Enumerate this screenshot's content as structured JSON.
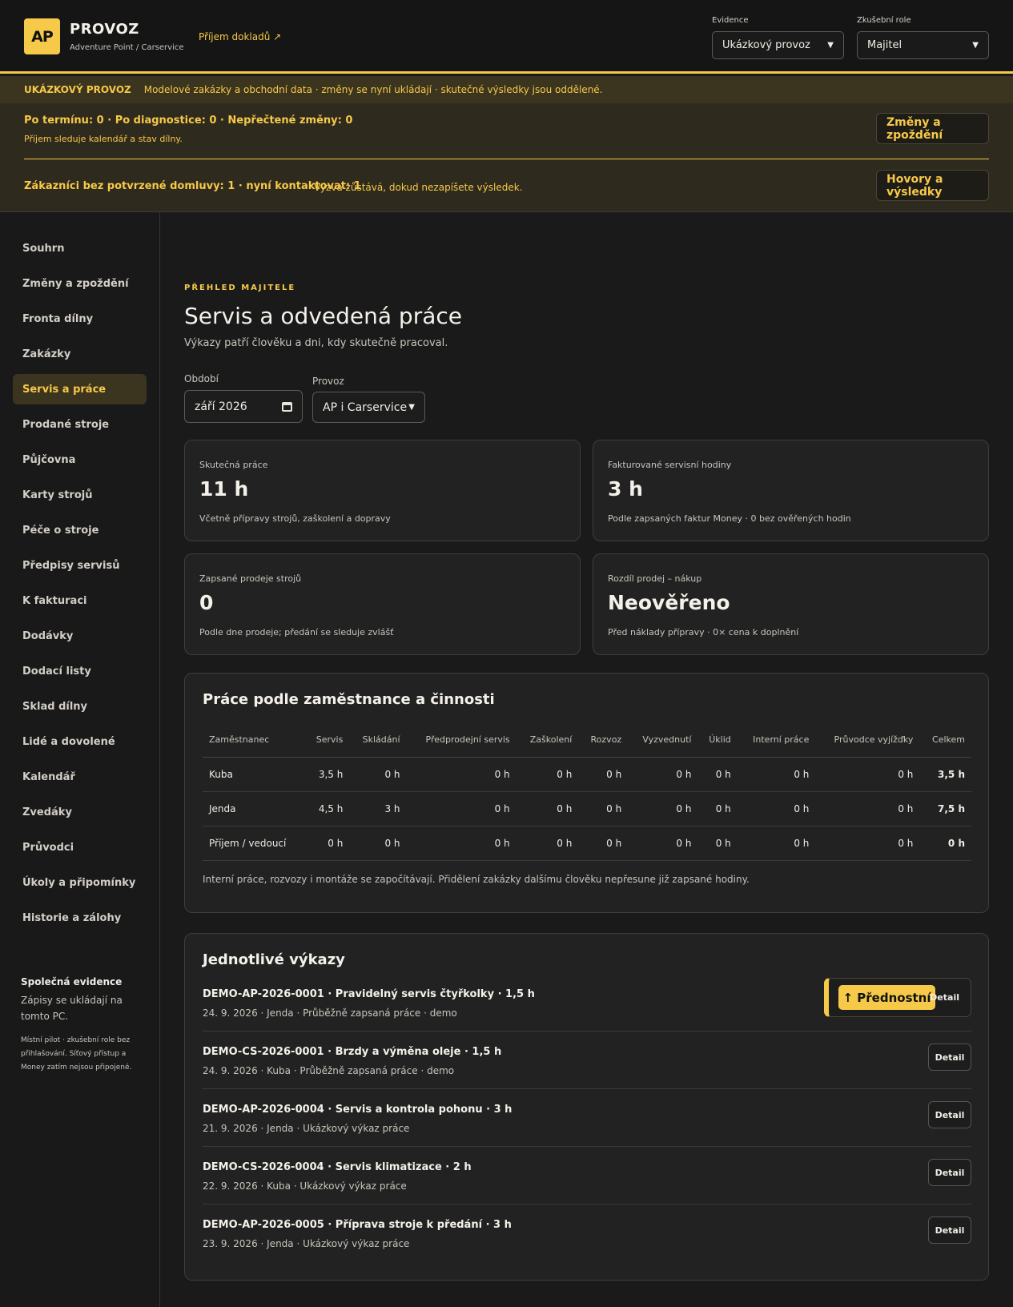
{
  "header": {
    "logo": "AP",
    "title": "PROVOZ",
    "subtitle": "Adventure Point / Carservice",
    "doc_link": "Příjem dokladů ↗",
    "evidence_label": "Evidence",
    "evidence_value": "Ukázkový provoz",
    "role_label": "Zkušební role",
    "role_value": "Majitel"
  },
  "demo_strip": {
    "tag": "UKÁZKOVÝ PROVOZ",
    "text": "Modelové zakázky a obchodní data · změny se nyní ukládají · skutečné výsledky jsou oddělené."
  },
  "alerts": {
    "line1": "Po termínu: 0 · Po diagnostice: 0 · Nepřečtené změny: 0",
    "line1_sub": "Příjem sleduje kalendář a stav dílny.",
    "button1": "Změny a zpoždění",
    "line2": "Zákazníci bez potvrzené domluvy: 1 · nyní kontaktovat: 1",
    "line2_sub": "Výzva zůstává, dokud nezapíšete výsledek.",
    "button2": "Hovory a výsledky"
  },
  "sidebar": {
    "items": [
      {
        "label": "Souhrn"
      },
      {
        "label": "Změny a zpoždění"
      },
      {
        "label": "Fronta dílny"
      },
      {
        "label": "Zakázky"
      },
      {
        "label": "Servis a práce"
      },
      {
        "label": "Prodané stroje"
      },
      {
        "label": "Půjčovna"
      },
      {
        "label": "Karty strojů"
      },
      {
        "label": "Péče o stroje"
      },
      {
        "label": "Předpisy servisů"
      },
      {
        "label": "K fakturaci"
      },
      {
        "label": "Dodávky"
      },
      {
        "label": "Dodací listy"
      },
      {
        "label": "Sklad dílny"
      },
      {
        "label": "Lidé a dovolené"
      },
      {
        "label": "Kalendář"
      },
      {
        "label": "Zvedáky"
      },
      {
        "label": "Průvodci"
      },
      {
        "label": "Úkoly a připomínky"
      },
      {
        "label": "Historie a zálohy"
      }
    ],
    "active": "Servis a práce",
    "footer_title": "Společná evidence",
    "footer_text": "Zápisy se ukládají na tomto PC.",
    "footer_small": "Místní pilot · zkušební role bez přihlašování. Síťový přístup a Money zatím nejsou připojené."
  },
  "main": {
    "eyebrow": "PŘEHLED MAJITELE",
    "title": "Servis a odvedená práce",
    "lead": "Výkazy patří člověku a dni, kdy skutečně pracoval.",
    "period_label": "Období",
    "period_value": "září 2026",
    "provoz_label": "Provoz",
    "provoz_value": "AP i Carservice"
  },
  "kpis": [
    {
      "label": "Skutečná práce",
      "value": "11 h",
      "note": "Včetně přípravy strojů, zaškolení a dopravy"
    },
    {
      "label": "Fakturované servisní hodiny",
      "value": "3 h",
      "note": "Podle zapsaných faktur Money · 0 bez ověřených hodin"
    },
    {
      "label": "Zapsané prodeje strojů",
      "value": "0",
      "note": "Podle dne prodeje; předání se sleduje zvlášť"
    },
    {
      "label": "Rozdíl prodej – nákup",
      "value": "Neověřeno",
      "note": "Před náklady přípravy · 0× cena k doplnění"
    }
  ],
  "work_table": {
    "title": "Práce podle zaměstnance a činnosti",
    "headers": [
      "Zaměstnanec",
      "Servis",
      "Skládání",
      "Předprodejní servis",
      "Zaškolení",
      "Rozvoz",
      "Vyzvednutí",
      "Úklid",
      "Interní práce",
      "Průvodce vyjížďky",
      "Celkem"
    ],
    "rows": [
      [
        "Kuba",
        "3,5 h",
        "0 h",
        "0 h",
        "0 h",
        "0 h",
        "0 h",
        "0 h",
        "0 h",
        "0 h",
        "3,5 h"
      ],
      [
        "Jenda",
        "4,5 h",
        "3 h",
        "0 h",
        "0 h",
        "0 h",
        "0 h",
        "0 h",
        "0 h",
        "0 h",
        "7,5 h"
      ],
      [
        "Příjem / vedoucí",
        "0 h",
        "0 h",
        "0 h",
        "0 h",
        "0 h",
        "0 h",
        "0 h",
        "0 h",
        "0 h",
        "0 h"
      ]
    ],
    "note": "Interní práce, rozvozy i montáže se započítávají. Přidělení zakázky dalšímu člověku nepřesune již zapsané hodiny."
  },
  "reports": {
    "title": "Jednotlivé výkazy",
    "priority_label": "↑ Přednostní",
    "detail_label": "Detail",
    "items": [
      {
        "title": "DEMO-AP-2026-0001 · Pravidelný servis čtyřkolky · 1,5 h",
        "meta": "24. 9. 2026 · Jenda · Průběžně zapsaná práce · demo"
      },
      {
        "title": "DEMO-CS-2026-0001 · Brzdy a výměna oleje · 1,5 h",
        "meta": "24. 9. 2026 · Kuba · Průběžně zapsaná práce · demo"
      },
      {
        "title": "DEMO-AP-2026-0004 · Servis a kontrola pohonu · 3 h",
        "meta": "21. 9. 2026 · Jenda · Ukázkový výkaz práce"
      },
      {
        "title": "DEMO-CS-2026-0004 · Servis klimatizace · 2 h",
        "meta": "22. 9. 2026 · Kuba · Ukázkový výkaz práce"
      },
      {
        "title": "DEMO-AP-2026-0005 · Příprava stroje k předání · 3 h",
        "meta": "23. 9. 2026 · Jenda · Ukázkový výkaz práce"
      }
    ]
  },
  "colors": {
    "accent": "#f7c948",
    "background": "#1a1a1a",
    "card": "#222222",
    "alert_bg": "#2e2a1e"
  }
}
